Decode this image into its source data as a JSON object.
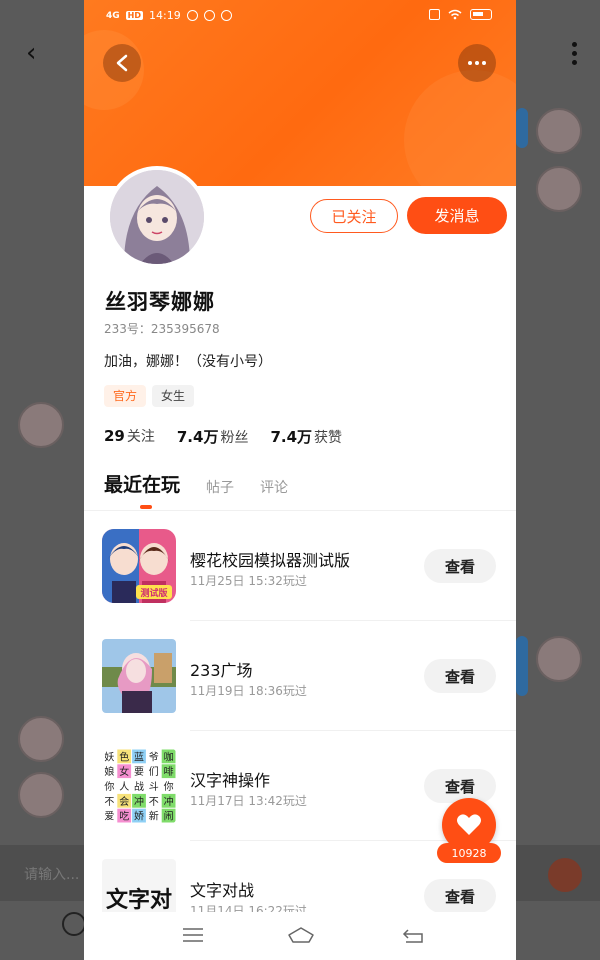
{
  "status": {
    "network": "4G",
    "hd": "HD",
    "time": "14:19"
  },
  "profile": {
    "name": "丝羽琴娜娜",
    "uid": "233号：235395678",
    "bio": "加油，娜娜！（没有小号）",
    "tags": [
      "官方",
      "女生"
    ],
    "follow_button": "已关注",
    "message_button": "发消息"
  },
  "stats": {
    "following_value": "29",
    "following_label": "关注",
    "fans_value": "7.4万",
    "fans_label": "粉丝",
    "likes_value": "7.4万",
    "likes_label": "获赞"
  },
  "tabs": [
    "最近在玩",
    "帖子",
    "评论"
  ],
  "games": [
    {
      "title": "樱花校园模拟器测试版",
      "time": "11月25日 15:32玩过",
      "button": "查看"
    },
    {
      "title": "233广场",
      "time": "11月19日 18:36玩过",
      "button": "查看"
    },
    {
      "title": "汉字神操作",
      "time": "11月17日 13:42玩过",
      "button": "查看"
    },
    {
      "title": "文字对战",
      "time": "11月14日 16:22玩过",
      "button": "查看"
    }
  ],
  "thumb_text": {
    "game1_badge": "测试版",
    "game3_chars": [
      "妖",
      "色",
      "蓝",
      "爷",
      "咖",
      "娘",
      "女",
      "要",
      "们",
      "啡",
      "你",
      "人",
      "战",
      "斗",
      "你",
      "不",
      "会",
      "冲",
      "不",
      "冲",
      "爱",
      "吃",
      "娇",
      "新",
      "闹"
    ],
    "game4_chars": "文字对"
  },
  "like": {
    "count": "10928"
  },
  "background": {
    "input_placeholder": "请输入..."
  },
  "colors": {
    "accent": "#ff4e14",
    "header": "#ff6a10"
  }
}
